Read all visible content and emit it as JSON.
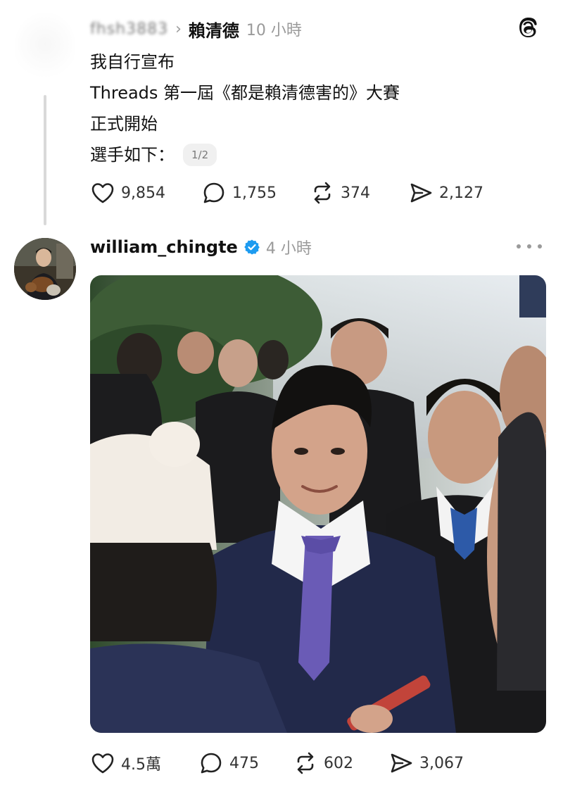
{
  "post1": {
    "blurred_user": "fhsh3883",
    "author": "賴清德",
    "time": "10 小時",
    "lines": [
      "我自行宣布",
      "Threads 第一屆《都是賴清德害的》大賽",
      "正式開始",
      "選手如下："
    ],
    "page_indicator": "1/2",
    "stats": {
      "likes": "9,854",
      "replies": "1,755",
      "reposts": "374",
      "shares": "2,127"
    }
  },
  "post2": {
    "username": "william_chingte",
    "time": "4 小時",
    "stats": {
      "likes": "4.5萬",
      "replies": "475",
      "reposts": "602",
      "shares": "3,067"
    }
  },
  "icons": {
    "like": "heart-icon",
    "reply": "comment-icon",
    "repost": "repost-icon",
    "share": "share-icon",
    "verified": "verified-badge-icon",
    "more": "more-options-icon",
    "logo": "threads-logo-icon"
  },
  "colors": {
    "verified": "#1d9bf0",
    "muted": "#9a9a9a",
    "thread_line": "#d9d9d9"
  }
}
